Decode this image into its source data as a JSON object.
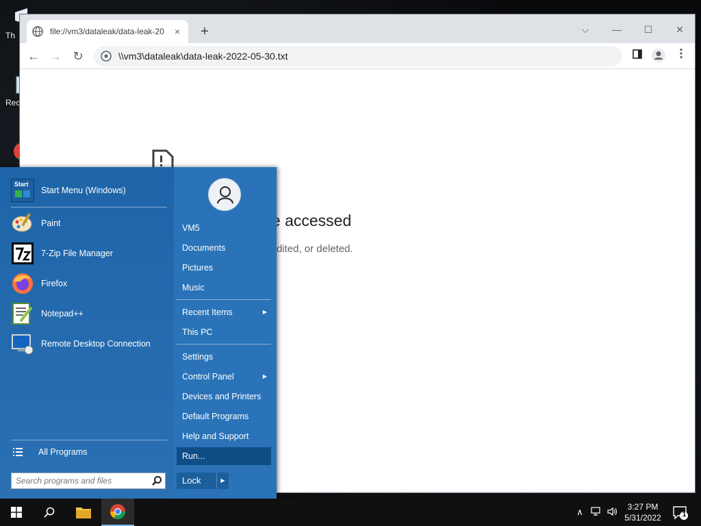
{
  "desktop": {
    "icons": [
      {
        "label": "Th"
      },
      {
        "label": "Rec"
      }
    ]
  },
  "browser": {
    "tab": {
      "title": "file://vm3/dataleak/data-leak-20",
      "close": "×"
    },
    "new_tab": "+",
    "window_controls": {
      "dropdown": "⌵",
      "minimize": "—",
      "maximize": "☐",
      "close": "✕"
    },
    "toolbar": {
      "back": "←",
      "forward": "→",
      "reload": "↻"
    },
    "omnibox": {
      "url": "\\\\vm3\\dataleak\\data-leak-2022-05-30.txt"
    },
    "error": {
      "title": "be accessed",
      "subtitle": "dited, or deleted."
    }
  },
  "start_menu": {
    "programs": [
      {
        "label": "Start Menu (Windows)",
        "icon": "start-menu-icon"
      },
      {
        "label": "Paint",
        "icon": "paint-icon"
      },
      {
        "label": "7-Zip File Manager",
        "icon": "7zip-icon"
      },
      {
        "label": "Firefox",
        "icon": "firefox-icon"
      },
      {
        "label": "Notepad++",
        "icon": "notepadpp-icon"
      },
      {
        "label": "Remote Desktop Connection",
        "icon": "remote-desktop-icon"
      }
    ],
    "start_icon_text": "Start",
    "all_programs": "All Programs",
    "search_placeholder": "Search programs and files",
    "right": {
      "user": "VM5",
      "items": [
        {
          "label": "Documents"
        },
        {
          "label": "Pictures"
        },
        {
          "label": "Music"
        },
        {
          "label": "Recent Items",
          "arrow": "▶"
        },
        {
          "label": "This PC"
        },
        {
          "label": "Settings"
        },
        {
          "label": "Control Panel",
          "arrow": "▶"
        },
        {
          "label": "Devices and Printers"
        },
        {
          "label": "Default Programs"
        },
        {
          "label": "Help and Support"
        },
        {
          "label": "Run..."
        }
      ],
      "lock": "Lock",
      "lock_arrow": "▶"
    }
  },
  "taskbar": {
    "clock_time": "3:27 PM",
    "clock_date": "5/31/2022",
    "tray_chevron": "∧",
    "notification_count": "1"
  }
}
